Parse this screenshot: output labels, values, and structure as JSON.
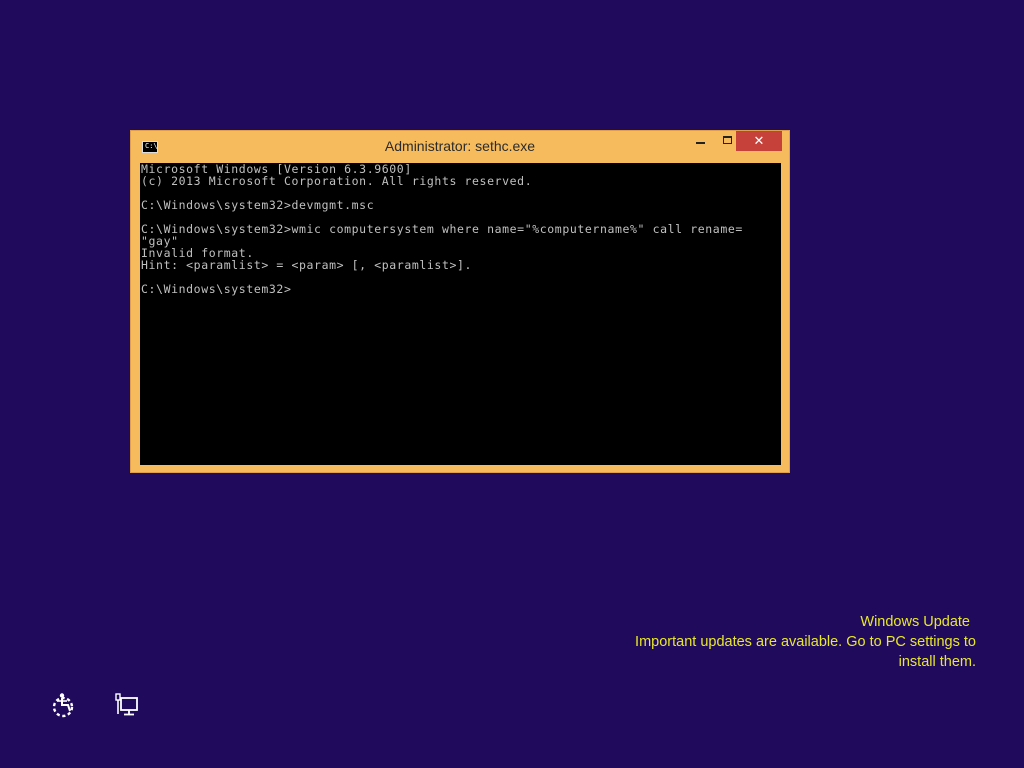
{
  "window": {
    "title": "Administrator: sethc.exe",
    "icon_label": "C:\\",
    "buttons": {
      "minimize": "minimize",
      "maximize": "maximize",
      "close": "✕"
    }
  },
  "console": {
    "lines": [
      "Microsoft Windows [Version 6.3.9600]",
      "(c) 2013 Microsoft Corporation. All rights reserved.",
      "",
      "C:\\Windows\\system32>devmgmt.msc",
      "",
      "C:\\Windows\\system32>wmic computersystem where name=\"%computername%\" call rename=",
      "\"gay\"",
      "Invalid format.",
      "Hint: <paramlist> = <param> [, <paramlist>].",
      "",
      "C:\\Windows\\system32>"
    ]
  },
  "notification": {
    "title": "Windows Update",
    "line1": "Important updates are available. Go to PC settings to",
    "line2": "install them."
  },
  "icons": {
    "ease_of_access": "ease-of-access-icon",
    "network": "network-icon"
  },
  "colors": {
    "desktop_background": "#1f0a5c",
    "window_frame": "#f6bb5c",
    "close_button": "#c7413b",
    "console_background": "#000000",
    "console_text": "#c0c0c0",
    "notification_text": "#e8e82a"
  }
}
